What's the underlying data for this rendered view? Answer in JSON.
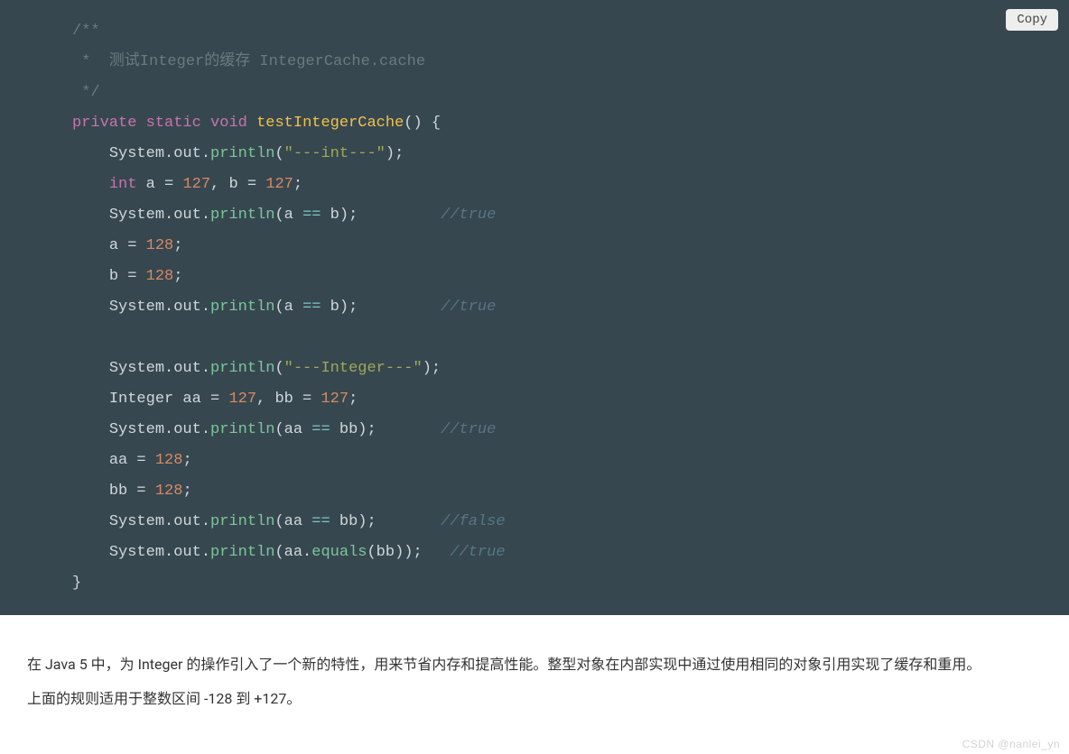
{
  "copy_label": "Copy",
  "code": {
    "l01": "/**",
    "l02": " *  测试Integer的缓存 IntegerCache.cache",
    "l03": " */",
    "kw_private": "private",
    "kw_static": "static",
    "kw_void": "void",
    "fn_name": "testIntegerCache",
    "paren_open_brace": "() {",
    "sys_out": "System.out.",
    "println": "println",
    "str_int": "\"---int---\"",
    "endcall": ");",
    "kw_int": "int",
    "decl_int": " a = ",
    "v127a": "127",
    "comma_b": ", b = ",
    "v127b": "127",
    "semi": ";",
    "print_ab_open": "(a ",
    "op_eq": "==",
    "print_ab_close": " b);",
    "pad_ab": "         ",
    "cmt_true": "//true",
    "assign_a": "a = ",
    "v128a": "128",
    "assign_b": "b = ",
    "v128b": "128",
    "str_integer": "\"---Integer---\"",
    "decl_Integer": "Integer aa = ",
    "v127aa": "127",
    "comma_bb": ", bb = ",
    "v127bb": "127",
    "print_aabb_open": "(aa ",
    "print_aabb_close": " bb);",
    "pad_aabb": "       ",
    "assign_aa": "aa = ",
    "v128aa": "128",
    "assign_bb": "bb = ",
    "v128bb": "128",
    "cmt_false": "//false",
    "equals_open": "(aa.",
    "equals_call": "equals",
    "equals_close": "(bb));",
    "pad_eq": "   ",
    "brace_close": "}"
  },
  "article": {
    "p1": "在 Java 5 中，为 Integer 的操作引入了一个新的特性，用来节省内存和提高性能。整型对象在内部实现中通过使用相同的对象引用实现了缓存和重用。",
    "p2": "上面的规则适用于整数区间 -128 到 +127。"
  },
  "watermark": "CSDN @nanlei_yn"
}
